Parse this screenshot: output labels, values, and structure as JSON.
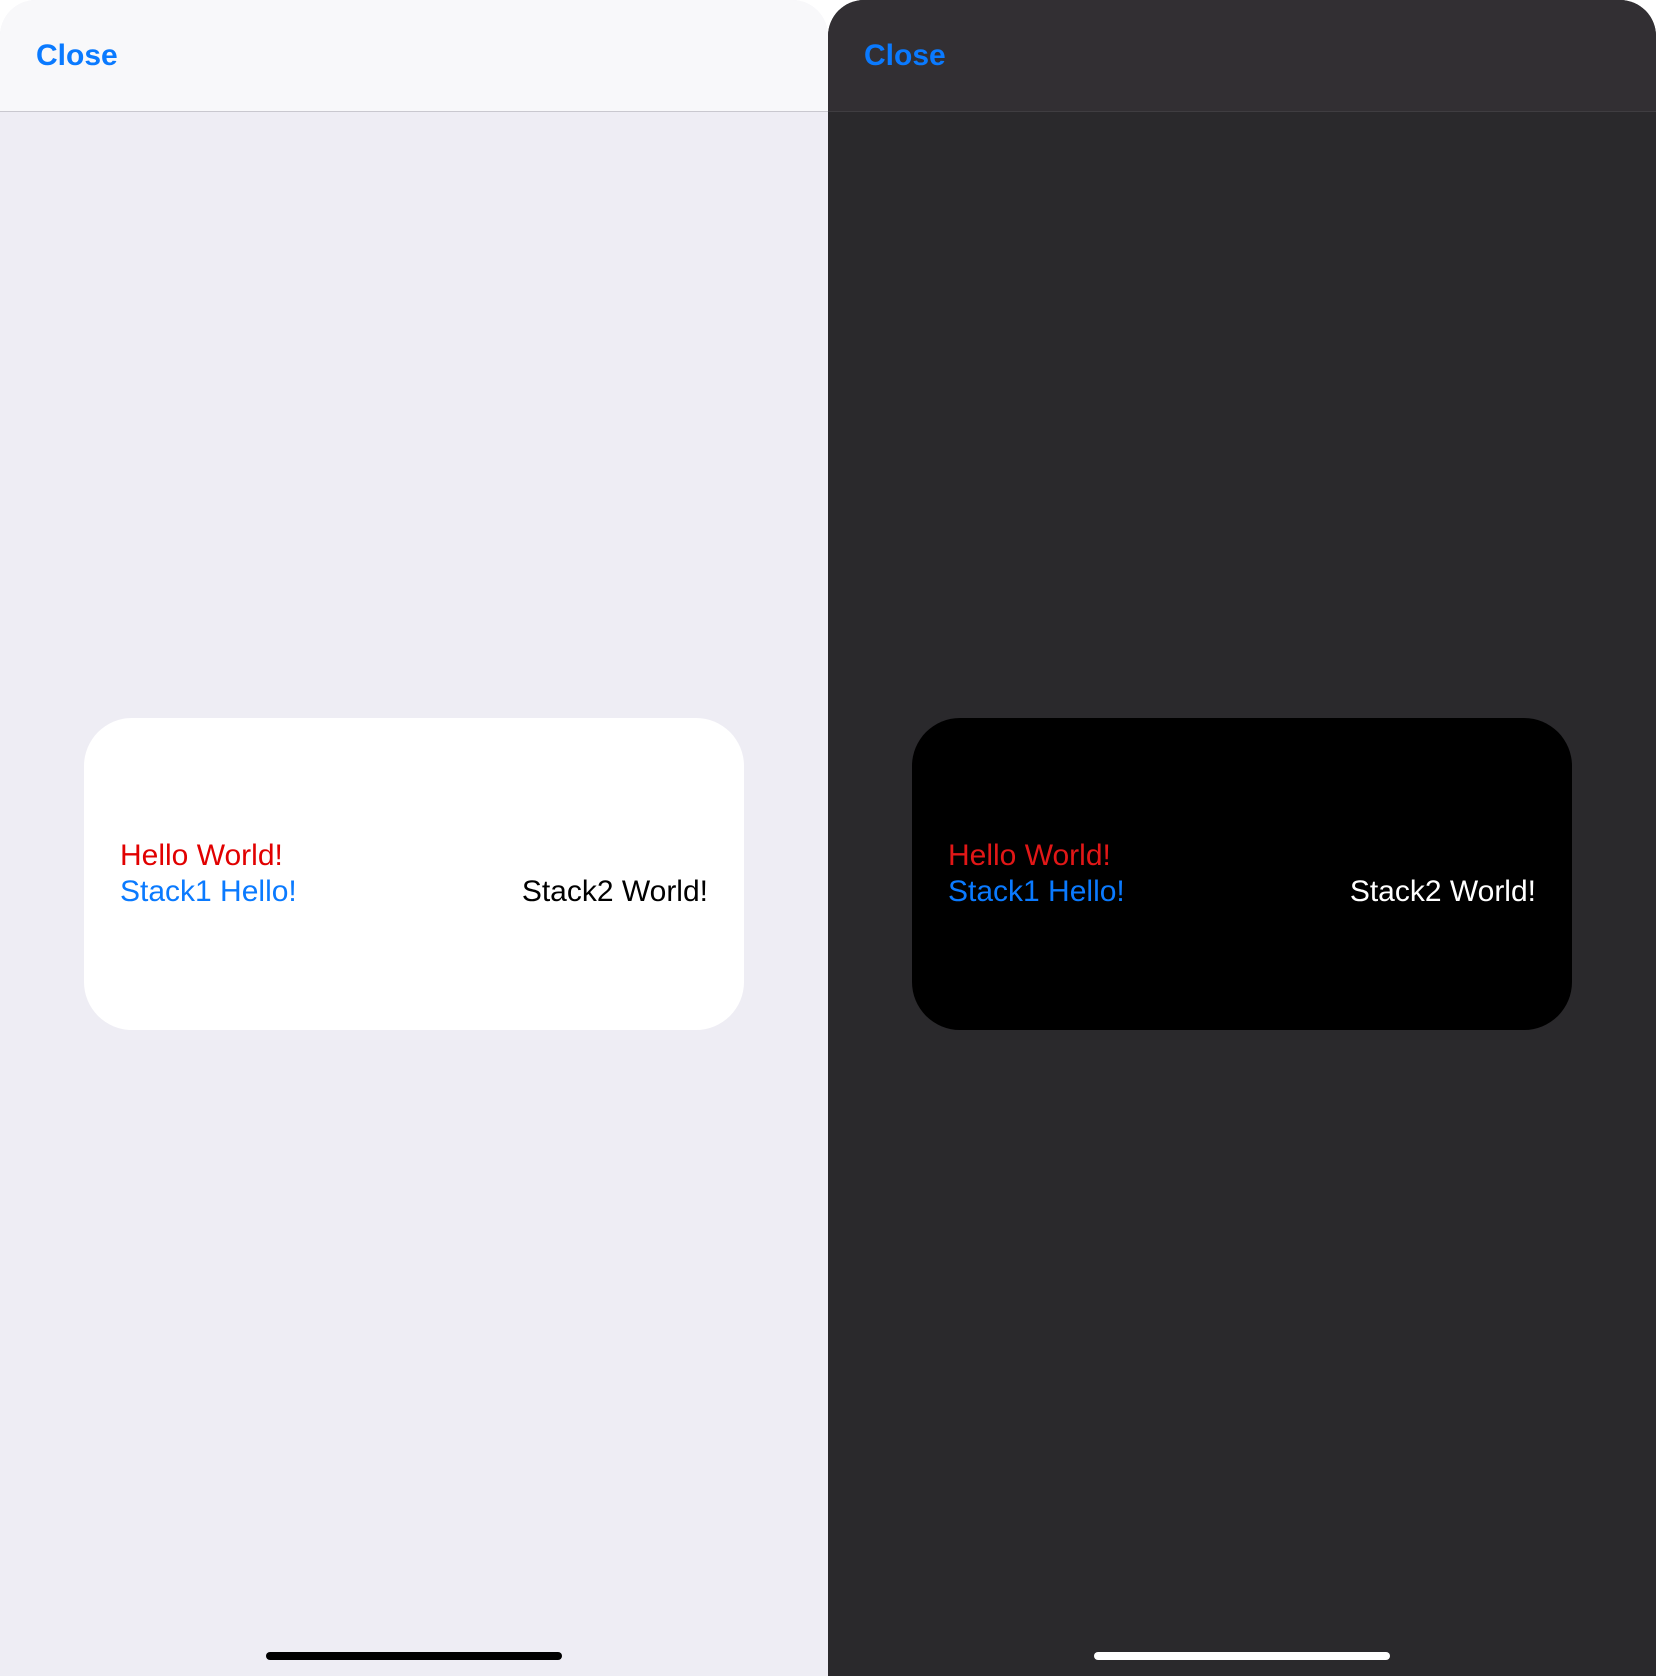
{
  "colors": {
    "accent": "#0a7aff",
    "red_light": "#e10000",
    "red_dark": "#e21717",
    "card_light": "#ffffff",
    "card_dark": "#000000",
    "bg_light": "#eeedf4",
    "bg_dark": "#2a292c",
    "navbar_light": "#f8f8fa",
    "navbar_dark": "#322f33"
  },
  "light": {
    "navbar": {
      "close_label": "Close"
    },
    "card": {
      "hello_text": "Hello World!",
      "stack1_text": "Stack1 Hello!",
      "stack2_text": "Stack2 World!"
    }
  },
  "dark": {
    "navbar": {
      "close_label": "Close"
    },
    "card": {
      "hello_text": "Hello World!",
      "stack1_text": "Stack1 Hello!",
      "stack2_text": "Stack2 World!"
    }
  }
}
